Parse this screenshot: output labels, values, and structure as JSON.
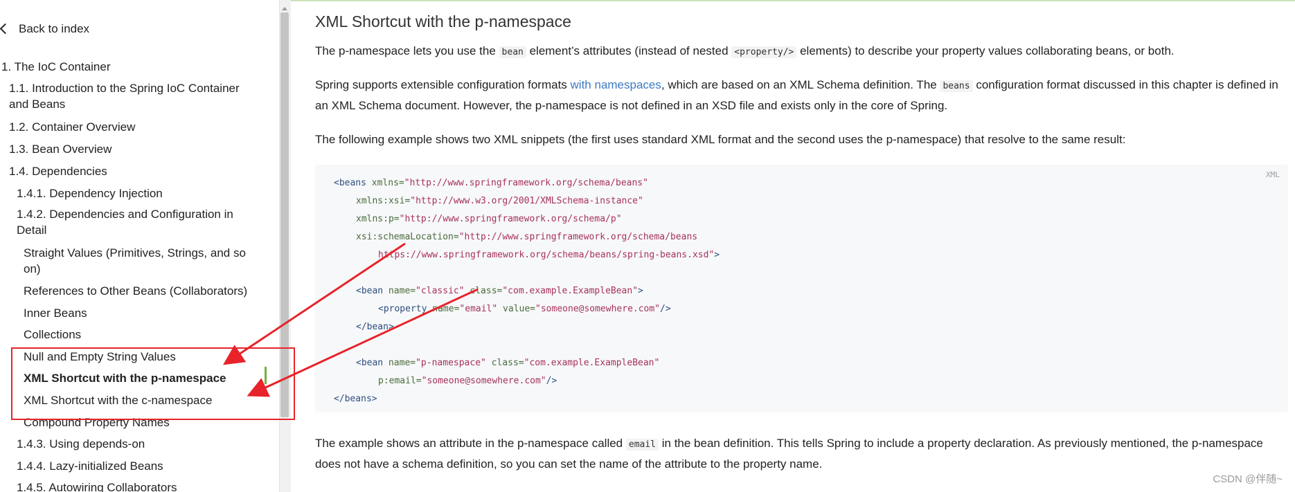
{
  "sidebar": {
    "back_label": "Back to index",
    "toc": [
      {
        "label": "1. The IoC Container"
      },
      {
        "label": "1.1. Introduction to the Spring IoC Container and Beans"
      },
      {
        "label": "1.2. Container Overview"
      },
      {
        "label": "1.3. Bean Overview"
      },
      {
        "label": "1.4. Dependencies"
      },
      {
        "label": "1.4.1. Dependency Injection"
      },
      {
        "label": "1.4.2. Dependencies and Configuration in Detail"
      },
      {
        "label": "Straight Values (Primitives, Strings, and so on)"
      },
      {
        "label": "References to Other Beans (Collaborators)"
      },
      {
        "label": "Inner Beans"
      },
      {
        "label": "Collections"
      },
      {
        "label": "Null and Empty String Values"
      },
      {
        "label": "XML Shortcut with the p-namespace",
        "active": true
      },
      {
        "label": "XML Shortcut with the c-namespace"
      },
      {
        "label": "Compound Property Names"
      },
      {
        "label": "1.4.3. Using depends-on"
      },
      {
        "label": "1.4.4. Lazy-initialized Beans"
      },
      {
        "label": "1.4.5. Autowiring Collaborators"
      }
    ]
  },
  "main": {
    "title": "XML Shortcut with the p-namespace",
    "p1": {
      "a": "The p-namespace lets you use the ",
      "code1": "bean",
      "b": " element’s attributes (instead of nested ",
      "code2": "<property/>",
      "c": " elements) to describe your property values collaborating beans, or both."
    },
    "p2": {
      "a": "Spring supports extensible configuration formats ",
      "link": "with namespaces",
      "b": ", which are based on an XML Schema definition. The ",
      "code": "beans",
      "c": " configuration format discussed in this chapter is defined in an XML Schema document. However, the p-namespace is not defined in an XSD file and exists only in the core of Spring."
    },
    "p3": "The following example shows two XML snippets (the first uses standard XML format and the second uses the p-namespace) that resolve to the same result:",
    "code_lang": "XML",
    "code": {
      "l1_tag": "<beans ",
      "l1_attr": "xmlns=",
      "l1_val": "\"http://www.springframework.org/schema/beans\"",
      "l2_attr": "xmlns:xsi=",
      "l2_val": "\"http://www.w3.org/2001/XMLSchema-instance\"",
      "l3_attr": "xmlns:p=",
      "l3_val": "\"http://www.springframework.org/schema/p\"",
      "l4_attr": "xsi:schemaLocation=",
      "l4_val": "\"http://www.springframework.org/schema/beans",
      "l5_val": "https://www.springframework.org/schema/beans/spring-beans.xsd\"",
      "l5_tag": ">",
      "l6_tag": "<bean ",
      "l6_attr1": "name=",
      "l6_val1": "\"classic\"",
      "l6_attr2": " class=",
      "l6_val2": "\"com.example.ExampleBean\"",
      "l6_end": ">",
      "l7_tag": "<property ",
      "l7_attr1": "name=",
      "l7_val1": "\"email\"",
      "l7_attr2": " value=",
      "l7_val2": "\"someone@somewhere.com\"",
      "l7_end": "/>",
      "l8_tag": "</bean>",
      "l9_tag": "<bean ",
      "l9_attr1": "name=",
      "l9_val1": "\"p-namespace\"",
      "l9_attr2": " class=",
      "l9_val2": "\"com.example.ExampleBean\"",
      "l10_attr": "p:email=",
      "l10_val": "\"someone@somewhere.com\"",
      "l10_end": "/>",
      "l11_tag": "</beans>"
    },
    "p4": {
      "a": "The example shows an attribute in the p-namespace called ",
      "code": "email",
      "b": " in the bean definition. This tells Spring to include a property declaration. As previously mentioned, the p-namespace does not have a schema definition, so you can set the name of the attribute to the property name."
    }
  },
  "watermark": "CSDN @伴随~",
  "colors": {
    "accent_green": "#6db33f",
    "annotation_red": "#e8232a",
    "link_blue": "#3c7ac4"
  }
}
